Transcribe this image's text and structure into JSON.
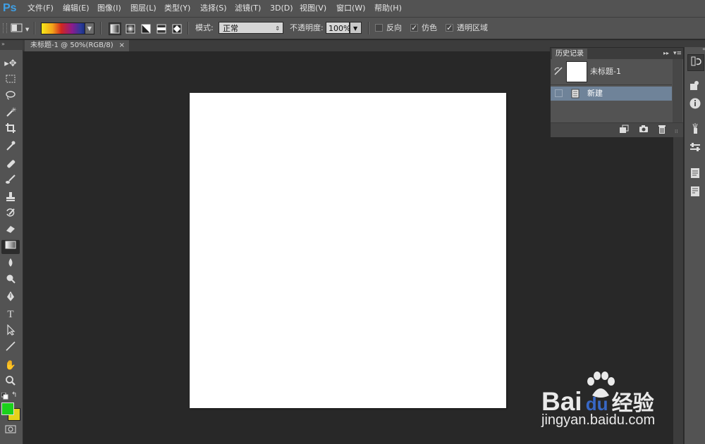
{
  "app": {
    "logo": "Ps"
  },
  "menu": [
    "文件(F)",
    "编辑(E)",
    "图像(I)",
    "图层(L)",
    "类型(Y)",
    "选择(S)",
    "滤镜(T)",
    "3D(D)",
    "视图(V)",
    "窗口(W)",
    "帮助(H)"
  ],
  "options": {
    "mode_label": "模式:",
    "mode_value": "正常",
    "opacity_label": "不透明度:",
    "opacity_value": "100%",
    "reverse_label": "反向",
    "dither_label": "仿色",
    "transparency_label": "透明区域",
    "reverse_checked": false,
    "dither_checked": true,
    "transparency_checked": true,
    "gradient_colors": [
      "#f7e81a",
      "#f2a21a",
      "#d2271f",
      "#8a1b8e",
      "#2a3b9a"
    ]
  },
  "document": {
    "tab_title": "未标题-1 @ 50%(RGB/8)",
    "close_glyph": "×"
  },
  "history": {
    "tab_label": "历史记录",
    "snapshot_name": "未标题-1",
    "states": [
      "新建"
    ]
  },
  "toolbar": {
    "foreground_color": "#1bd11b",
    "background_color": "#e6d21a",
    "text_tool_glyph": "T"
  },
  "watermark": {
    "brand": "Bai",
    "brand_suffix": "经验",
    "url": "jingyan.baidu.com",
    "du": "du"
  }
}
